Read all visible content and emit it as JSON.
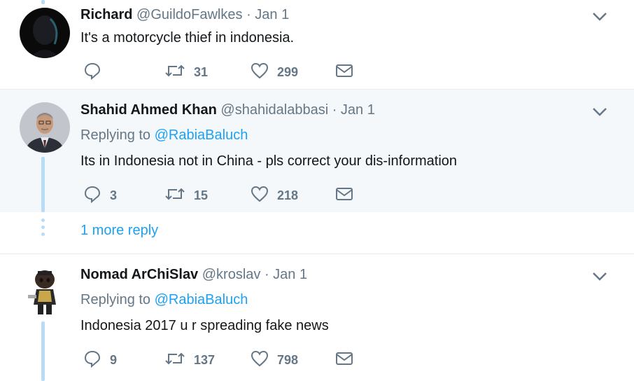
{
  "tweets": [
    {
      "name": "Richard",
      "handle": "@GuildoFawlkes",
      "date": "· Jan 1",
      "text": "It's a motorcycle thief in indonesia.",
      "replies": "",
      "retweets": "31",
      "likes": "299"
    },
    {
      "name": "Shahid Ahmed Khan",
      "handle": "@shahidalabbasi",
      "date": "· Jan 1",
      "replying_prefix": "Replying to",
      "replying_to": "@RabiaBaluch",
      "text": "Its in Indonesia not in China - pls correct your dis-information",
      "replies": "3",
      "retweets": "15",
      "likes": "218"
    },
    {
      "name": "Nomad ArChiSlav",
      "handle": "@kroslav",
      "date": "· Jan 1",
      "replying_prefix": "Replying to",
      "replying_to": "@RabiaBaluch",
      "text": "Indonesia 2017 u r spreading fake news",
      "replies": "9",
      "retweets": "137",
      "likes": "798"
    }
  ],
  "more_reply_label": "1 more reply",
  "colors": {
    "accent": "#1da1f2",
    "muted": "#657786",
    "thread": "#b8dcf5",
    "highlight": "#f5f8fa"
  },
  "icons": [
    "reply-icon",
    "retweet-icon",
    "like-icon",
    "direct-message-icon",
    "caret-down-icon"
  ]
}
